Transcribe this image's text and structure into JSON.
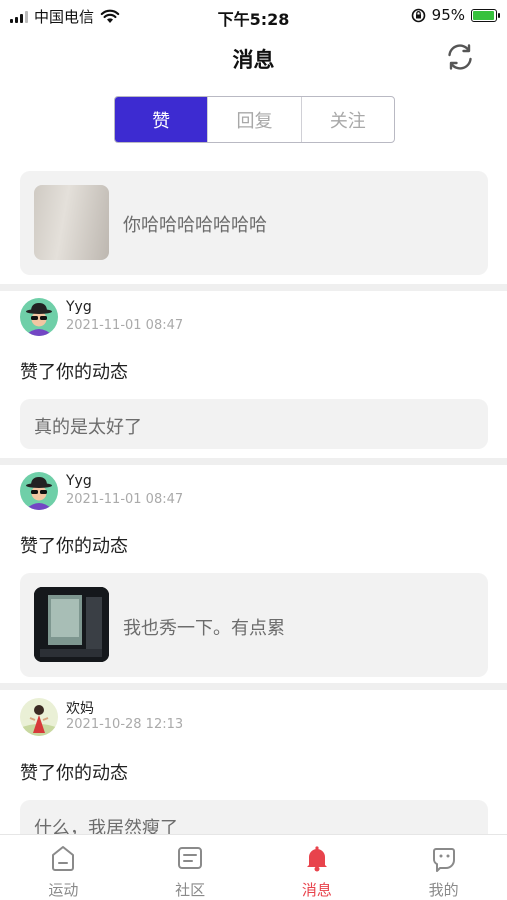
{
  "status_bar": {
    "carrier": "中国电信",
    "time": "下午5:28",
    "battery": "95%",
    "battery_level": 0.95,
    "icons": [
      "signal-icon",
      "wifi-icon",
      "orientation-lock-icon",
      "battery-charging-icon"
    ]
  },
  "header": {
    "title": "消息",
    "refresh_icon": "refresh-icon"
  },
  "tabs": [
    {
      "label": "赞",
      "active": true
    },
    {
      "label": "回复",
      "active": false
    },
    {
      "label": "关注",
      "active": false
    }
  ],
  "top_card": {
    "text": "你哈哈哈哈哈哈哈"
  },
  "notifications": [
    {
      "user": "Yyg",
      "time": "2021-11-01 08:47",
      "action": "赞了你的动态",
      "quote": "真的是太好了"
    },
    {
      "user": "Yyg",
      "time": "2021-11-01 08:47",
      "action": "赞了你的动态",
      "quote": "我也秀一下。有点累"
    },
    {
      "user": "欢妈",
      "time": "2021-10-28 12:13",
      "action": "赞了你的动态",
      "quote": "什么，我居然瘦了"
    }
  ],
  "bottom_nav": [
    {
      "label": "运动",
      "icon": "home-icon",
      "active": false
    },
    {
      "label": "社区",
      "icon": "community-icon",
      "active": false
    },
    {
      "label": "消息",
      "icon": "bell-icon",
      "active": true
    },
    {
      "label": "我的",
      "icon": "profile-icon",
      "active": false
    }
  ],
  "colors": {
    "accent": "#3d2bd1",
    "active_nav": "#e8434c",
    "card_bg": "#f2f2f2"
  }
}
